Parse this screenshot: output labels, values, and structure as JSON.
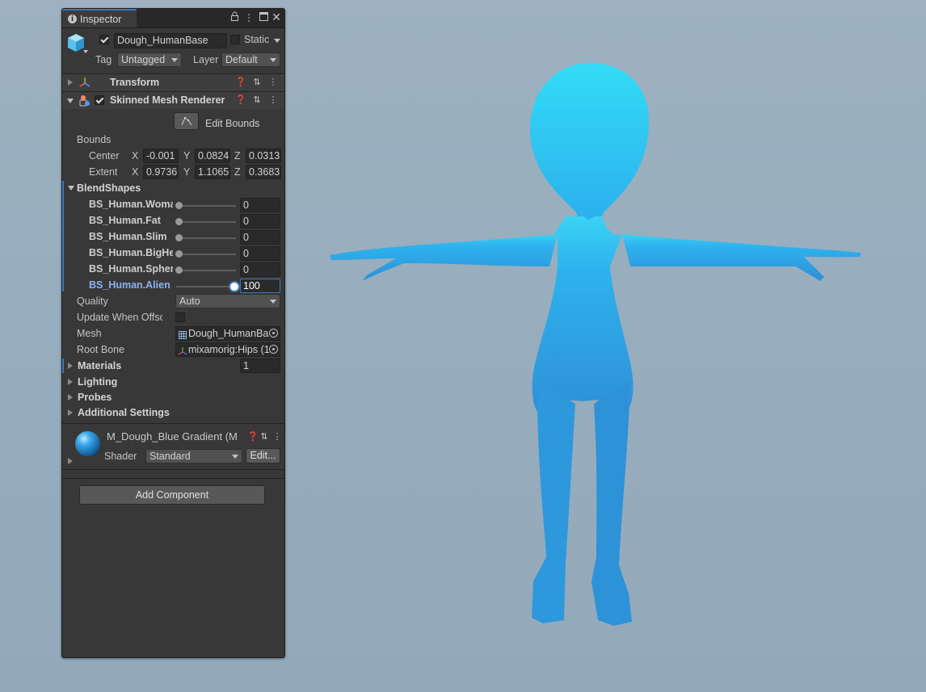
{
  "inspector": {
    "tab_label": "Inspector",
    "object_name": "Dough_HumanBase",
    "static_label": "Static",
    "tag_label": "Tag",
    "tag_value": "Untagged",
    "layer_label": "Layer",
    "layer_value": "Default"
  },
  "transform": {
    "title": "Transform"
  },
  "skinned_mesh": {
    "title": "Skinned Mesh Renderer",
    "edit_bounds": "Edit Bounds",
    "bounds_label": "Bounds",
    "center_label": "Center",
    "center": {
      "x": "-0.001",
      "y": "0.0824",
      "z": "0.0313"
    },
    "extent_label": "Extent",
    "extent": {
      "x": "0.9736",
      "y": "1.1065",
      "z": "0.3683"
    },
    "axis_x": "X",
    "axis_y": "Y",
    "axis_z": "Z",
    "blendshapes_label": "BlendShapes",
    "blendshapes": [
      {
        "name": "BS_Human.Woma",
        "value": "0",
        "level": 0
      },
      {
        "name": "BS_Human.Fat",
        "value": "0",
        "level": 0
      },
      {
        "name": "BS_Human.Slim",
        "value": "0",
        "level": 0
      },
      {
        "name": "BS_Human.BigHea",
        "value": "0",
        "level": 0
      },
      {
        "name": "BS_Human.Sphere",
        "value": "0",
        "level": 0
      },
      {
        "name": "BS_Human.Alien",
        "value": "100",
        "level": 1
      }
    ],
    "quality_label": "Quality",
    "quality_value": "Auto",
    "update_offscreen_label": "Update When Offscre",
    "mesh_label": "Mesh",
    "mesh_value": "Dough_HumanBa",
    "root_bone_label": "Root Bone",
    "root_bone_value": "mixamorig:Hips (1",
    "materials_label": "Materials",
    "materials_count": "1",
    "lighting_label": "Lighting",
    "probes_label": "Probes",
    "additional_label": "Additional Settings"
  },
  "material": {
    "name": "M_Dough_Blue Gradient (M",
    "shader_label": "Shader",
    "shader_value": "Standard",
    "edit_label": "Edit..."
  },
  "add_component": "Add Component",
  "colors": {
    "accent": "#3a79bb",
    "character": "#2f9fe4",
    "background": "#9aafbf"
  }
}
